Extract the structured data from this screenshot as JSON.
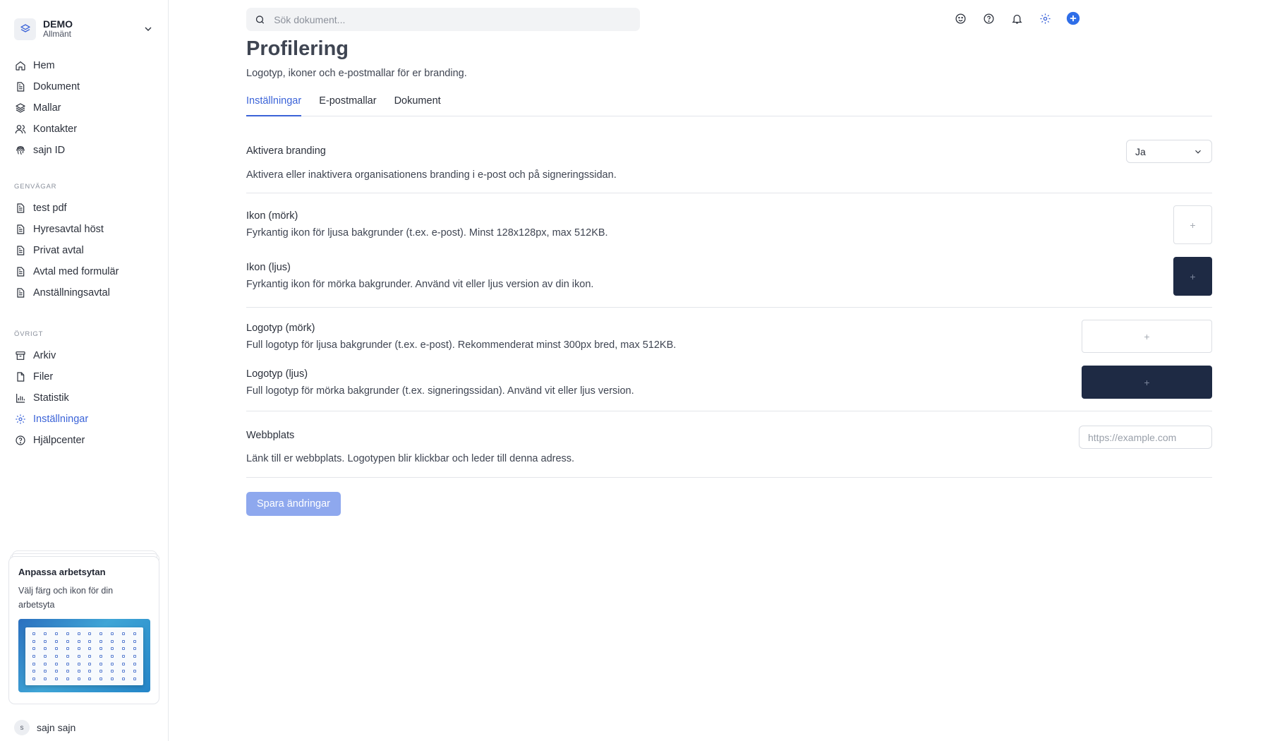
{
  "workspace": {
    "name": "DEMO",
    "subtitle": "Allmänt"
  },
  "nav_main": [
    {
      "label": "Hem",
      "icon": "home-icon"
    },
    {
      "label": "Dokument",
      "icon": "document-icon"
    },
    {
      "label": "Mallar",
      "icon": "layers-icon"
    },
    {
      "label": "Kontakter",
      "icon": "users-icon"
    },
    {
      "label": "sajn ID",
      "icon": "fingerprint-icon"
    }
  ],
  "shortcuts": {
    "title": "GENVÄGAR",
    "items": [
      {
        "label": "test pdf"
      },
      {
        "label": "Hyresavtal höst"
      },
      {
        "label": "Privat avtal"
      },
      {
        "label": "Avtal med formulär"
      },
      {
        "label": "Anställningsavtal"
      }
    ]
  },
  "other": {
    "title": "ÖVRIGT",
    "items": [
      {
        "label": "Arkiv",
        "icon": "archive-icon"
      },
      {
        "label": "Filer",
        "icon": "file-icon"
      },
      {
        "label": "Statistik",
        "icon": "chart-icon"
      },
      {
        "label": "Inställningar",
        "icon": "gear-icon",
        "active": true
      },
      {
        "label": "Hjälpcenter",
        "icon": "help-icon"
      }
    ]
  },
  "promo": {
    "title": "Anpassa arbetsytan",
    "text": "Välj färg och ikon för din arbetsyta"
  },
  "user": {
    "initial": "s",
    "name": "sajn sajn"
  },
  "search": {
    "placeholder": "Sök dokument..."
  },
  "page": {
    "title": "Profilering",
    "subtitle": "Logotyp, ikoner och e-postmallar för er branding."
  },
  "tabs": [
    {
      "label": "Inställningar",
      "active": true
    },
    {
      "label": "E-postmallar"
    },
    {
      "label": "Dokument"
    }
  ],
  "branding": {
    "label": "Aktivera branding",
    "value": "Ja",
    "desc": "Aktivera eller inaktivera organisationens branding i e-post och på signeringssidan."
  },
  "icon_dark": {
    "label": "Ikon (mörk)",
    "desc": "Fyrkantig ikon för ljusa bakgrunder (t.ex. e-post). Minst 128x128px, max 512KB."
  },
  "icon_light": {
    "label": "Ikon (ljus)",
    "desc": "Fyrkantig ikon för mörka bakgrunder. Använd vit eller ljus version av din ikon."
  },
  "logo_dark": {
    "label": "Logotyp (mörk)",
    "desc": "Full logotyp för ljusa bakgrunder (t.ex. e-post). Rekommenderat minst 300px bred, max 512KB."
  },
  "logo_light": {
    "label": "Logotyp (ljus)",
    "desc": "Full logotyp för mörka bakgrunder (t.ex. signeringssidan). Använd vit eller ljus version."
  },
  "upload_symbol": "+",
  "website": {
    "label": "Webbplats",
    "placeholder": "https://example.com",
    "desc": "Länk till er webbplats. Logotypen blir klickbar och leder till denna adress."
  },
  "save_label": "Spara ändringar",
  "colors": {
    "accent": "#3b63d8",
    "save_button": "#8ea8ee",
    "dark_upload": "#1e2a44"
  }
}
